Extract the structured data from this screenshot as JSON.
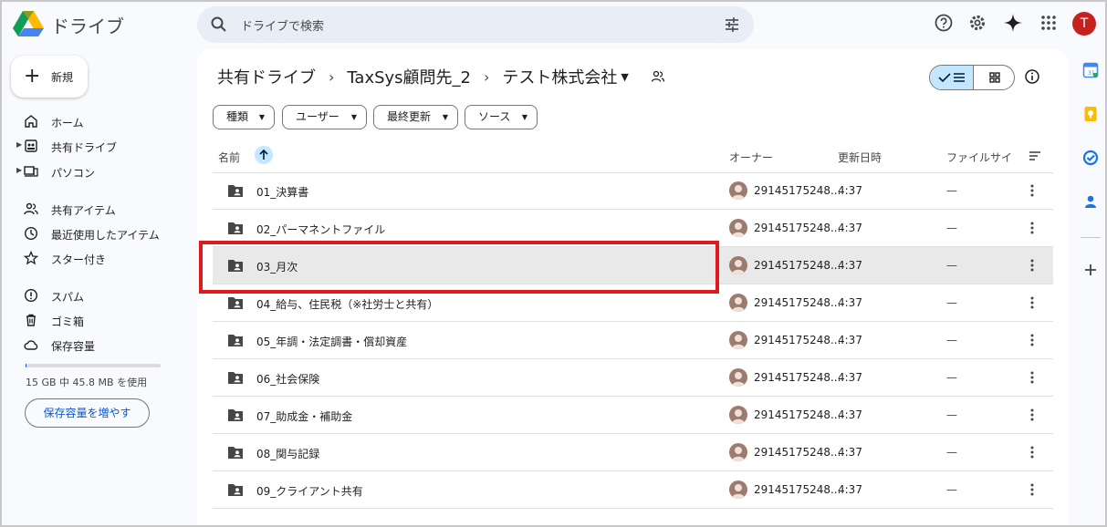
{
  "header": {
    "app_name": "ドライブ",
    "search_placeholder": "ドライブで検索",
    "avatar_letter": "T"
  },
  "sidebar": {
    "new_label": "新規",
    "items": [
      {
        "label": "ホーム",
        "icon": "home-icon"
      },
      {
        "label": "共有ドライブ",
        "icon": "shared-drives-icon"
      },
      {
        "label": "パソコン",
        "icon": "computers-icon"
      },
      {
        "label": "共有アイテム",
        "icon": "shared-with-me-icon"
      },
      {
        "label": "最近使用したアイテム",
        "icon": "recent-icon"
      },
      {
        "label": "スター付き",
        "icon": "star-icon"
      },
      {
        "label": "スパム",
        "icon": "spam-icon"
      },
      {
        "label": "ゴミ箱",
        "icon": "trash-icon"
      },
      {
        "label": "保存容量",
        "icon": "cloud-icon"
      }
    ],
    "storage_text": "15 GB 中 45.8 MB を使用",
    "storage_fraction": 0.003,
    "storage_button": "保存容量を増やす"
  },
  "breadcrumb": {
    "items": [
      "共有ドライブ",
      "TaxSys顧問先_2",
      "テスト株式会社"
    ],
    "separator": "›"
  },
  "filters": [
    "種類",
    "ユーザー",
    "最終更新",
    "ソース"
  ],
  "table": {
    "columns": {
      "name": "名前",
      "owner": "オーナー",
      "modified": "更新日時",
      "size": "ファイルサイ"
    },
    "rows": [
      {
        "name": "01_決算書",
        "owner": "29145175248...",
        "modified": "4:37",
        "size": "—"
      },
      {
        "name": "02_パーマネントファイル",
        "owner": "29145175248...",
        "modified": "4:37",
        "size": "—"
      },
      {
        "name": "03_月次",
        "owner": "29145175248...",
        "modified": "4:37",
        "size": "—"
      },
      {
        "name": "04_給与、住民税（※社労士と共有）",
        "owner": "29145175248...",
        "modified": "4:37",
        "size": "—"
      },
      {
        "name": "05_年調・法定調書・償却資産",
        "owner": "29145175248...",
        "modified": "4:37",
        "size": "—"
      },
      {
        "name": "06_社会保険",
        "owner": "29145175248...",
        "modified": "4:37",
        "size": "—"
      },
      {
        "name": "07_助成金・補助金",
        "owner": "29145175248...",
        "modified": "4:37",
        "size": "—"
      },
      {
        "name": "08_関与記録",
        "owner": "29145175248...",
        "modified": "4:37",
        "size": "—"
      },
      {
        "name": "09_クライアント共有",
        "owner": "29145175248...",
        "modified": "4:37",
        "size": "—"
      }
    ],
    "selected_row": 2
  },
  "colors": {
    "accent": "#0b57d0",
    "selected_toggle": "#c2e7ff",
    "highlight": "#e0191d"
  }
}
